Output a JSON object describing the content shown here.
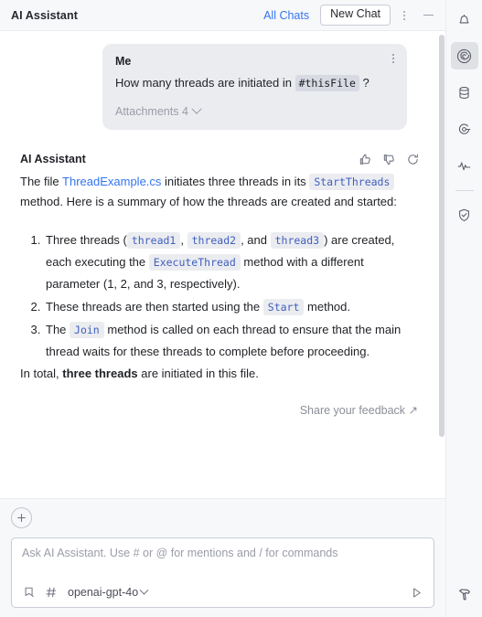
{
  "topbar": {
    "title": "AI Assistant",
    "all_chats_label": "All Chats",
    "new_chat_label": "New Chat",
    "more_icon": "kebab-menu-icon",
    "minimize_icon": "minimize-icon"
  },
  "user_message": {
    "author": "Me",
    "text_before": "How many threads are initiated in",
    "mention": "#thisFile",
    "text_after": "?",
    "attachments_label": "Attachments 4",
    "more_icon": "kebab-menu-icon"
  },
  "assistant_message": {
    "author": "AI Assistant",
    "actions": [
      "thumbs-up-icon",
      "thumbs-down-icon",
      "regenerate-icon"
    ],
    "intro": {
      "p1": "The file",
      "file_link": "ThreadExample.cs",
      "p2": "initiates three threads in its",
      "method": "StartThreads",
      "p3": "method. Here is a summary of how the threads are created and started:"
    },
    "steps": [
      {
        "t1": "Three threads (",
        "c1": "thread1",
        "t2": ",",
        "c2": "thread2",
        "t3": ", and",
        "c3": "thread3",
        "t4": ") are created, each executing the",
        "c4": "ExecuteThread",
        "t5": "method with a different parameter (1, 2, and 3, respectively)."
      },
      {
        "t1": "These threads are then started using the",
        "c1": "Start",
        "t2": "method."
      },
      {
        "t1": "The",
        "c1": "Join",
        "t2": "method is called on each thread to ensure that the main thread waits for these threads to complete before proceeding."
      }
    ],
    "total": {
      "before": "In total,",
      "bold": "three threads",
      "after": "are initiated in this file."
    },
    "feedback_label": "Share your feedback ↗"
  },
  "composer": {
    "add_icon": "plus-circle-icon",
    "placeholder": "Ask AI Assistant. Use # or @ for mentions and / for commands",
    "value": "",
    "attach_icon": "attach-context-icon",
    "hash_icon": "hash-icon",
    "model": "openai-gpt-4o",
    "send_icon": "send-icon"
  },
  "rail": {
    "items": [
      {
        "name": "notifications",
        "icon": "bell-icon",
        "active": false
      },
      {
        "name": "ai-assistant",
        "icon": "spiral-icon",
        "active": true
      },
      {
        "name": "database",
        "icon": "database-icon",
        "active": false
      },
      {
        "name": "endpoints",
        "icon": "endpoints-icon",
        "active": false
      },
      {
        "name": "profiler",
        "icon": "activity-icon",
        "active": false
      },
      {
        "name": "security",
        "icon": "shield-check-icon",
        "active": false
      }
    ],
    "bottom": {
      "name": "build",
      "icon": "hammer-icon"
    }
  },
  "colors": {
    "accent_link": "#3574f0",
    "code_text": "#3f5fbf",
    "bubble_bg": "#ebecf0",
    "chrome_bg": "#f7f8fa"
  }
}
